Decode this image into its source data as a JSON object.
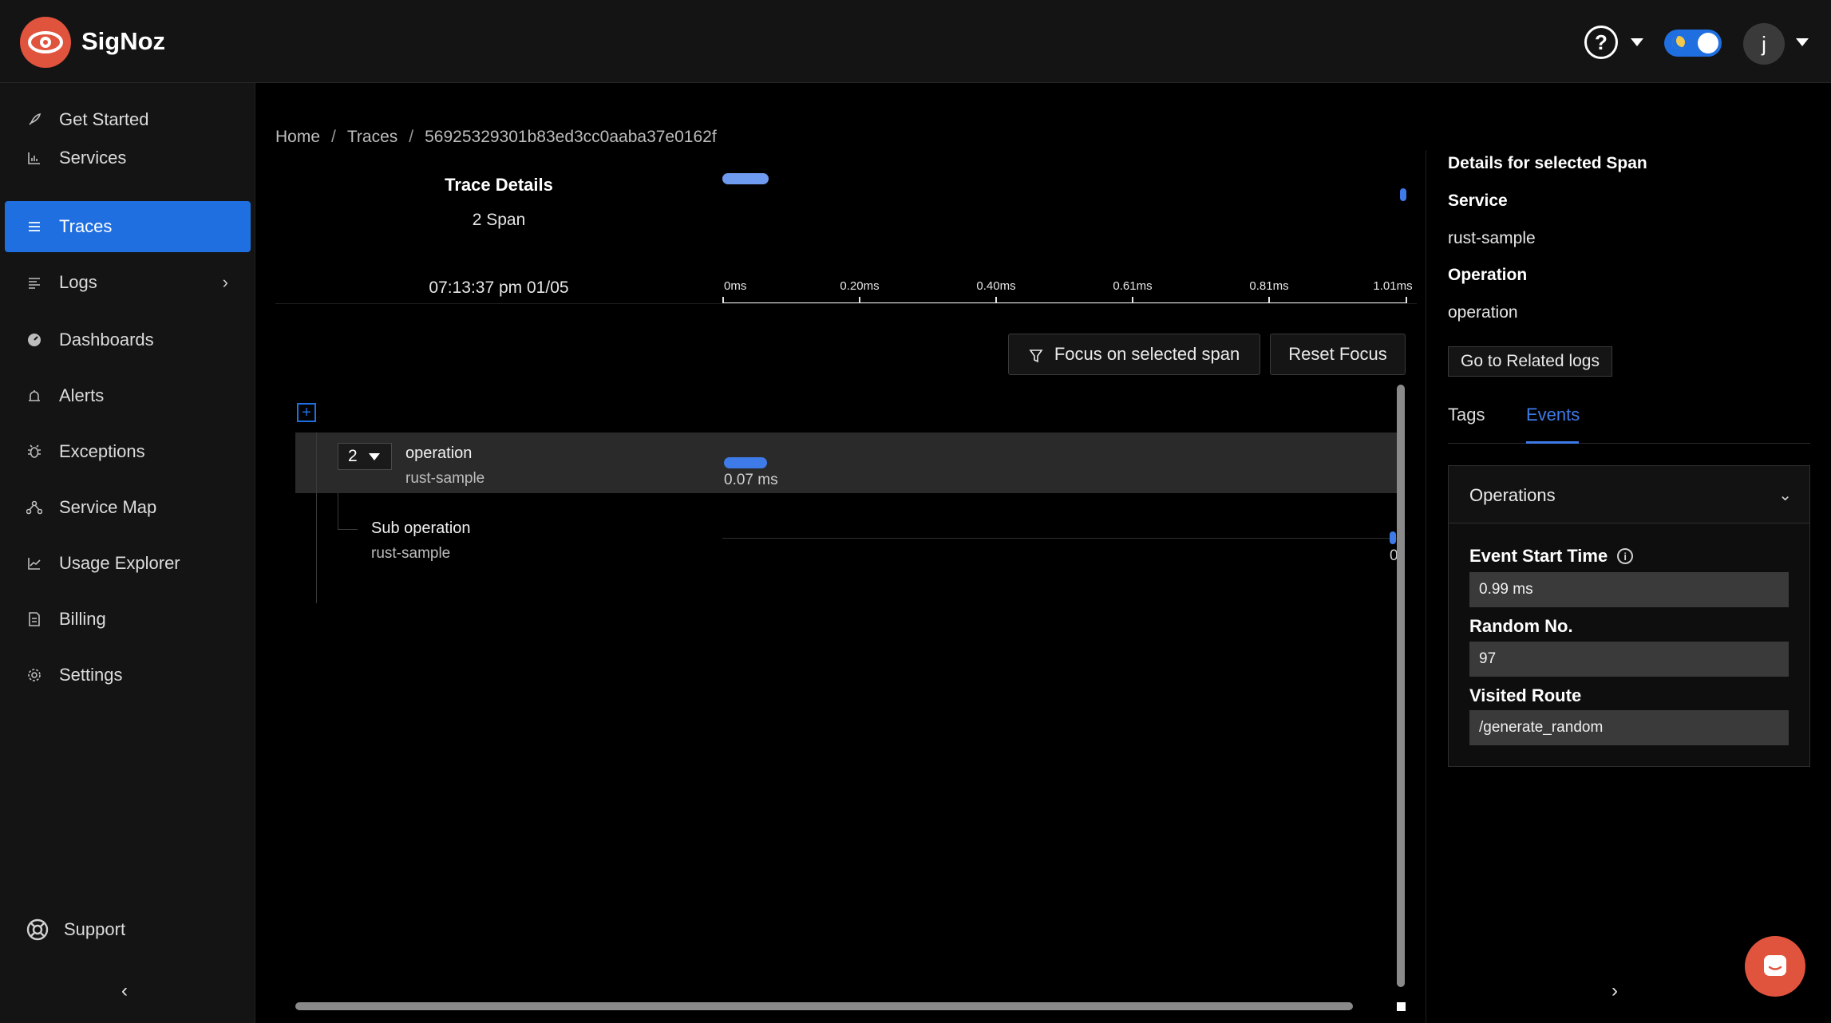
{
  "app": {
    "name": "SigNoz"
  },
  "header": {
    "help_icon": "question-circle-icon",
    "avatar_initial": "j"
  },
  "sidebar": {
    "items": [
      {
        "label": "Get Started",
        "icon": "rocket-icon"
      },
      {
        "label": "Services",
        "icon": "bar-chart-icon"
      },
      {
        "label": "Traces",
        "icon": "menu-lines-icon",
        "active": true
      },
      {
        "label": "Logs",
        "icon": "list-align-icon",
        "has_submenu": true
      },
      {
        "label": "Dashboards",
        "icon": "dashboard-icon"
      },
      {
        "label": "Alerts",
        "icon": "alarm-icon"
      },
      {
        "label": "Exceptions",
        "icon": "bug-icon"
      },
      {
        "label": "Service Map",
        "icon": "deployment-icon"
      },
      {
        "label": "Usage Explorer",
        "icon": "line-chart-icon"
      },
      {
        "label": "Billing",
        "icon": "file-icon"
      },
      {
        "label": "Settings",
        "icon": "gear-icon"
      }
    ],
    "support_label": "Support"
  },
  "breadcrumb": {
    "home": "Home",
    "traces": "Traces",
    "trace_id": "56925329301b83ed3cc0aaba37e0162f"
  },
  "trace": {
    "title": "Trace Details",
    "span_count": "2 Span",
    "timestamp": "07:13:37 pm 01/05",
    "ticks": [
      "0ms",
      "0.20ms",
      "0.40ms",
      "0.61ms",
      "0.81ms",
      "1.01ms"
    ],
    "focus_button": "Focus on selected span",
    "reset_button": "Reset Focus",
    "spans": [
      {
        "count": "2",
        "name": "operation",
        "service": "rust-sample",
        "duration": "0.07 ms"
      },
      {
        "name": "Sub operation",
        "service": "rust-sample",
        "duration": "0"
      }
    ]
  },
  "details": {
    "title": "Details for selected Span",
    "service_label": "Service",
    "service_value": "rust-sample",
    "operation_label": "Operation",
    "operation_value": "operation",
    "related_logs_button": "Go to Related logs",
    "tabs": [
      "Tags",
      "Events"
    ],
    "active_tab": "Events",
    "events_card": {
      "title": "Operations",
      "fields": [
        {
          "label": "Event Start Time",
          "value": "0.99 ms",
          "info": true
        },
        {
          "label": "Random No.",
          "value": "97"
        },
        {
          "label": "Visited Route",
          "value": "/generate_random"
        }
      ]
    }
  },
  "colors": {
    "accent": "#1f6fe0",
    "brand": "#e0533d",
    "span_bar": "#3f7be8"
  }
}
